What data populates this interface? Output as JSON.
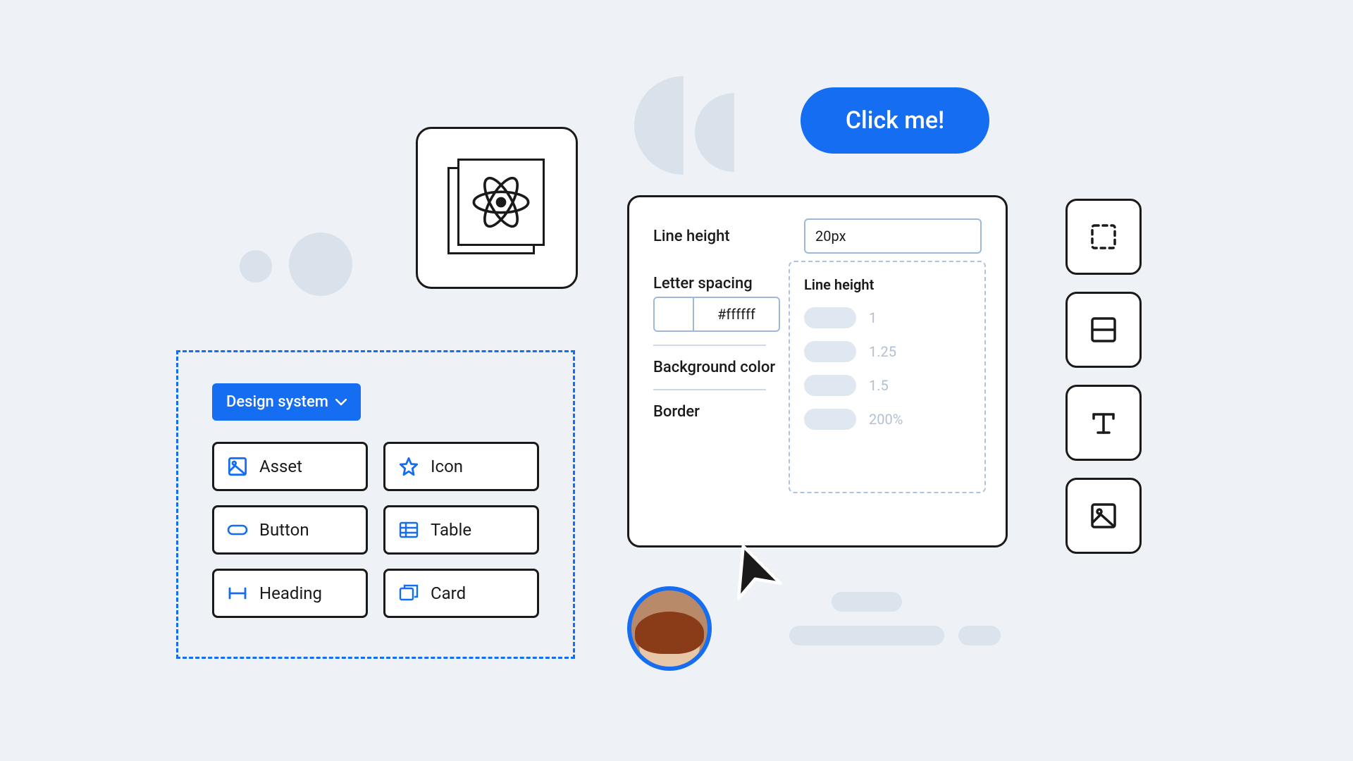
{
  "colors": {
    "accent": "#156df2"
  },
  "click_button": {
    "label": "Click me!"
  },
  "design_system": {
    "dropdown_label": "Design system",
    "items": [
      {
        "label": "Asset",
        "icon": "image-icon"
      },
      {
        "label": "Icon",
        "icon": "star-icon"
      },
      {
        "label": "Button",
        "icon": "pill-icon"
      },
      {
        "label": "Table",
        "icon": "table-icon"
      },
      {
        "label": "Heading",
        "icon": "heading-icon"
      },
      {
        "label": "Card",
        "icon": "card-icon"
      }
    ]
  },
  "props": {
    "line_height": {
      "label": "Line height",
      "value": "20px"
    },
    "letter_spacing": {
      "label": "Letter spacing"
    },
    "color": {
      "hex": "#ffffff"
    },
    "background": {
      "label": "Background color"
    },
    "border": {
      "label": "Border"
    },
    "lh_popover": {
      "title": "Line height",
      "options": [
        "1",
        "1.25",
        "1.5",
        "200%"
      ]
    }
  },
  "tools": [
    {
      "name": "select-marquee-icon"
    },
    {
      "name": "split-horizontal-icon"
    },
    {
      "name": "text-icon"
    },
    {
      "name": "image-tool-icon"
    }
  ]
}
